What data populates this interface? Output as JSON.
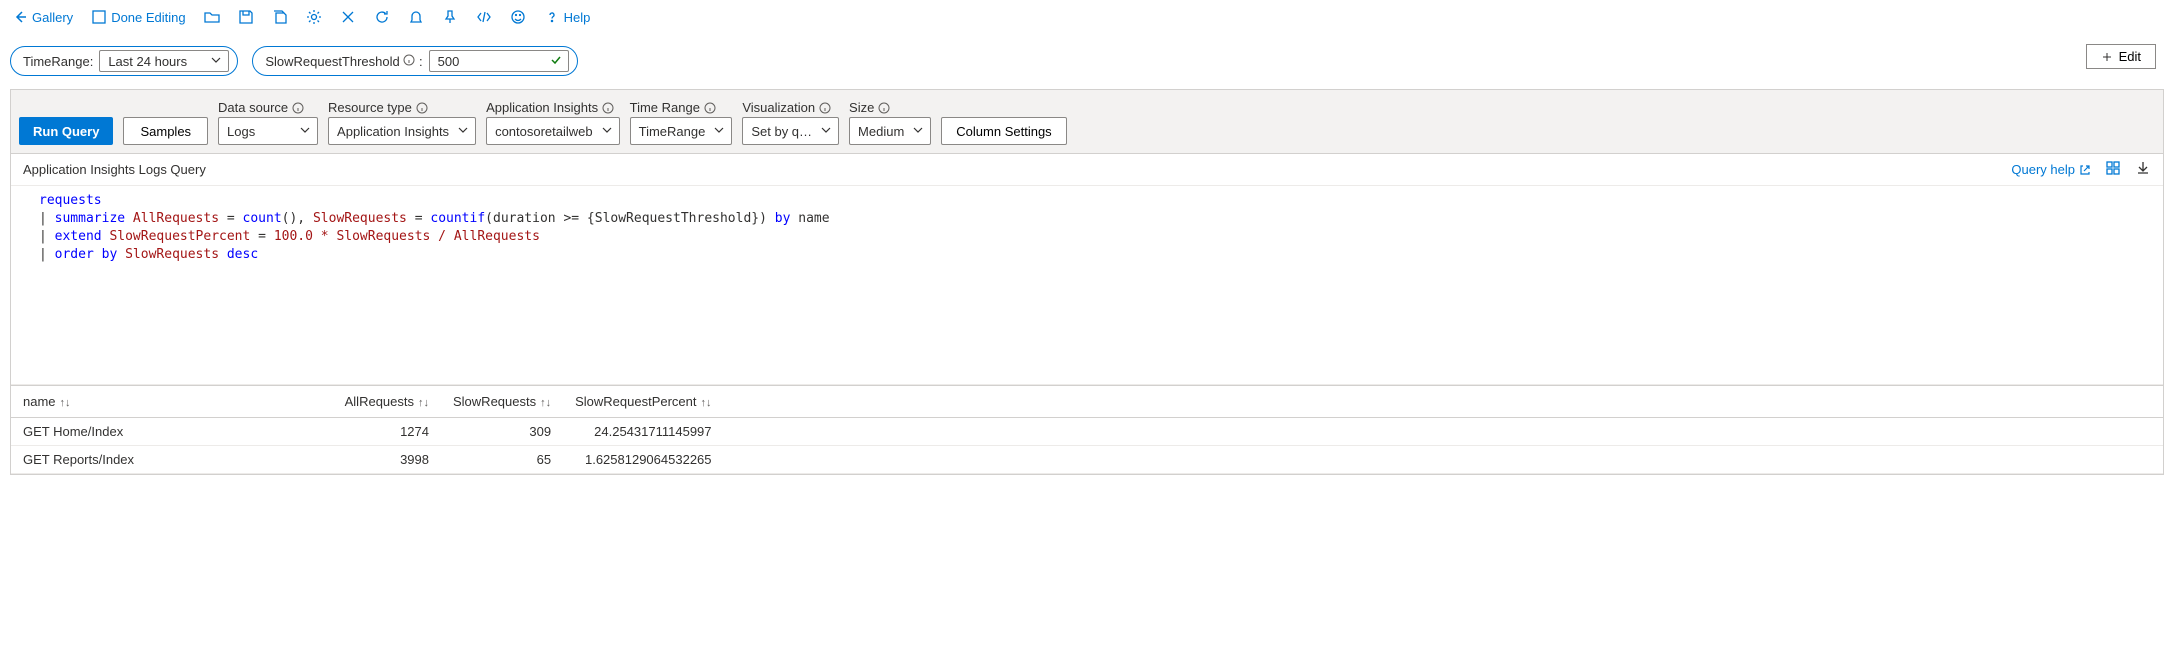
{
  "toolbar": {
    "gallery": "Gallery",
    "doneEditing": "Done Editing",
    "help": "Help"
  },
  "params": {
    "timeRange": {
      "label": "TimeRange:",
      "value": "Last 24 hours"
    },
    "slowThreshold": {
      "label": "SlowRequestThreshold",
      "sep": ":",
      "value": "500"
    }
  },
  "editBtn": "Edit",
  "config": {
    "runQuery": "Run Query",
    "samples": "Samples",
    "dataSource": {
      "label": "Data source",
      "value": "Logs"
    },
    "resourceType": {
      "label": "Resource type",
      "value": "Application Insights"
    },
    "appInsights": {
      "label": "Application Insights",
      "value": "contosoretailweb"
    },
    "timeRange": {
      "label": "Time Range",
      "value": "TimeRange"
    },
    "visualization": {
      "label": "Visualization",
      "value": "Set by q…"
    },
    "size": {
      "label": "Size",
      "value": "Medium"
    },
    "columnSettings": "Column Settings"
  },
  "queryHeader": {
    "title": "Application Insights Logs Query",
    "help": "Query help"
  },
  "query": {
    "l1": "requests",
    "l2_pipe": "| ",
    "l2_kw": "summarize",
    "l2_a": " AllRequests ",
    "l2_eq": "=",
    "l2_fn1": " count",
    "l2_p1": "(), ",
    "l2_b": "SlowRequests ",
    "l2_eq2": "=",
    "l2_fn2": " countif",
    "l2_p2": "(duration >= {SlowRequestThreshold}) ",
    "l2_by": "by",
    "l2_name": " name",
    "l3_pipe": "| ",
    "l3_kw": "extend",
    "l3_a": " SlowRequestPercent ",
    "l3_eq": "=",
    "l3_expr": " 100.0 * SlowRequests / AllRequests",
    "l4_pipe": "| ",
    "l4_kw": "order by",
    "l4_a": " SlowRequests ",
    "l4_desc": "desc"
  },
  "table": {
    "cols": {
      "name": "name",
      "all": "AllRequests",
      "slow": "SlowRequests",
      "pct": "SlowRequestPercent"
    },
    "rows": [
      {
        "name": "GET Home/Index",
        "all": "1274",
        "slow": "309",
        "pct": "24.25431711145997"
      },
      {
        "name": "GET Reports/Index",
        "all": "3998",
        "slow": "65",
        "pct": "1.6258129064532265"
      }
    ]
  }
}
